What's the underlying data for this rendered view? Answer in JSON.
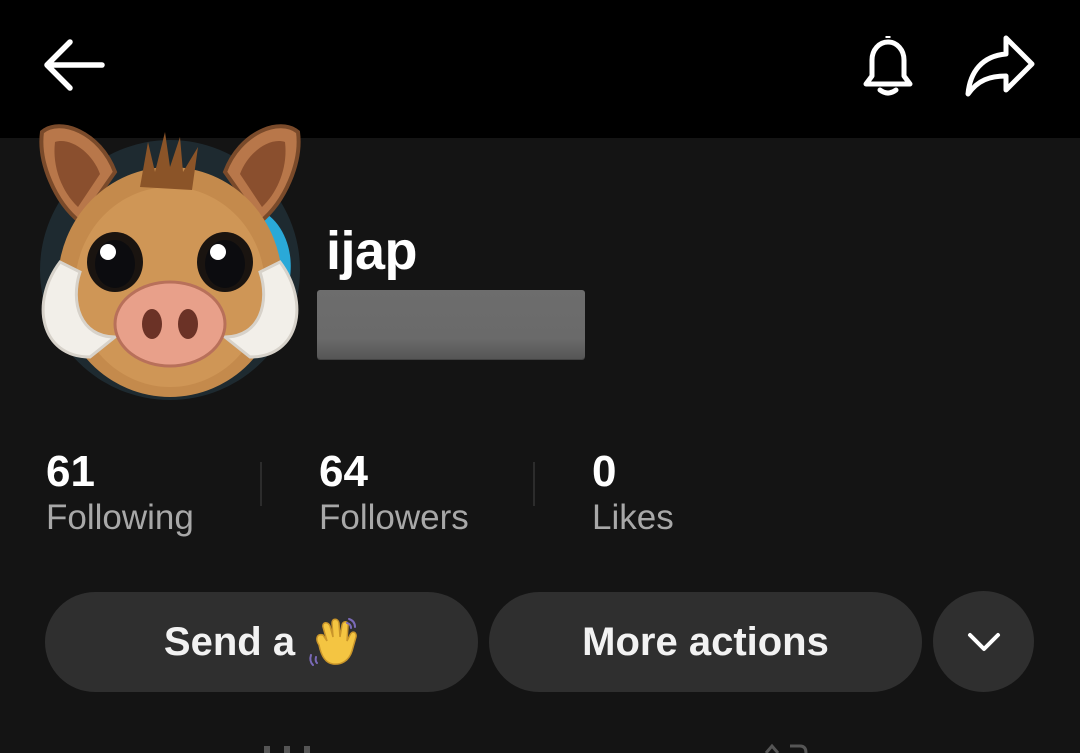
{
  "profile": {
    "username": "ijap"
  },
  "stats": [
    {
      "value": "61",
      "label": "Following"
    },
    {
      "value": "64",
      "label": "Followers"
    },
    {
      "value": "0",
      "label": "Likes"
    }
  ],
  "actions": {
    "send_label": "Send a",
    "more_label": "More actions"
  },
  "icons": {
    "back": "arrow-left-icon",
    "notifications": "bell-icon",
    "share": "share-arrow-icon",
    "send_emoji": "waving-hand-emoji",
    "expand": "chevron-down-icon"
  },
  "colors": {
    "background": "#141414",
    "topbar": "#000000",
    "button": "#2f2f2f",
    "secondary_text": "#a8a8a8"
  }
}
